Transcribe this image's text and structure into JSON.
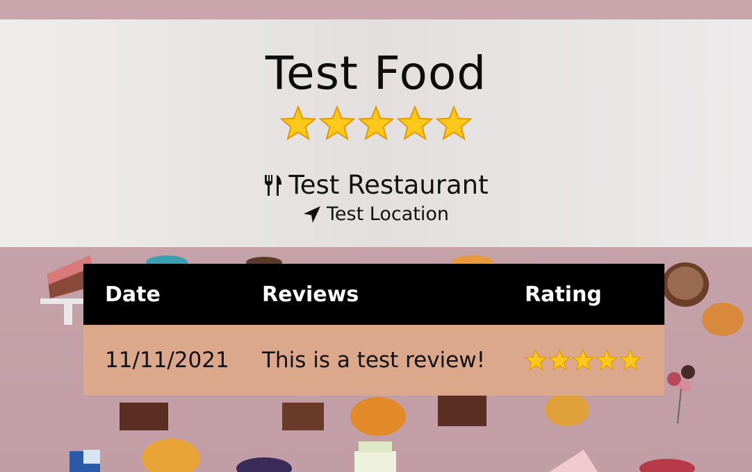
{
  "food": {
    "title": "Test Food",
    "rating_stars": 5
  },
  "restaurant": {
    "name": "Test Restaurant",
    "icon": "utensils-icon"
  },
  "location": {
    "name": "Test Location",
    "icon": "location-arrow-icon"
  },
  "reviews_table": {
    "columns": [
      "Date",
      "Reviews",
      "Rating"
    ],
    "rows": [
      {
        "date": "11/11/2021",
        "review": "This is a test review!",
        "rating_stars": 5
      }
    ]
  },
  "colors": {
    "background": "#c6a3aa",
    "header_panel": "#e8e5e4",
    "table_header": "#000000",
    "table_row": "#dba88c",
    "star_fill": "#ffc81a"
  }
}
